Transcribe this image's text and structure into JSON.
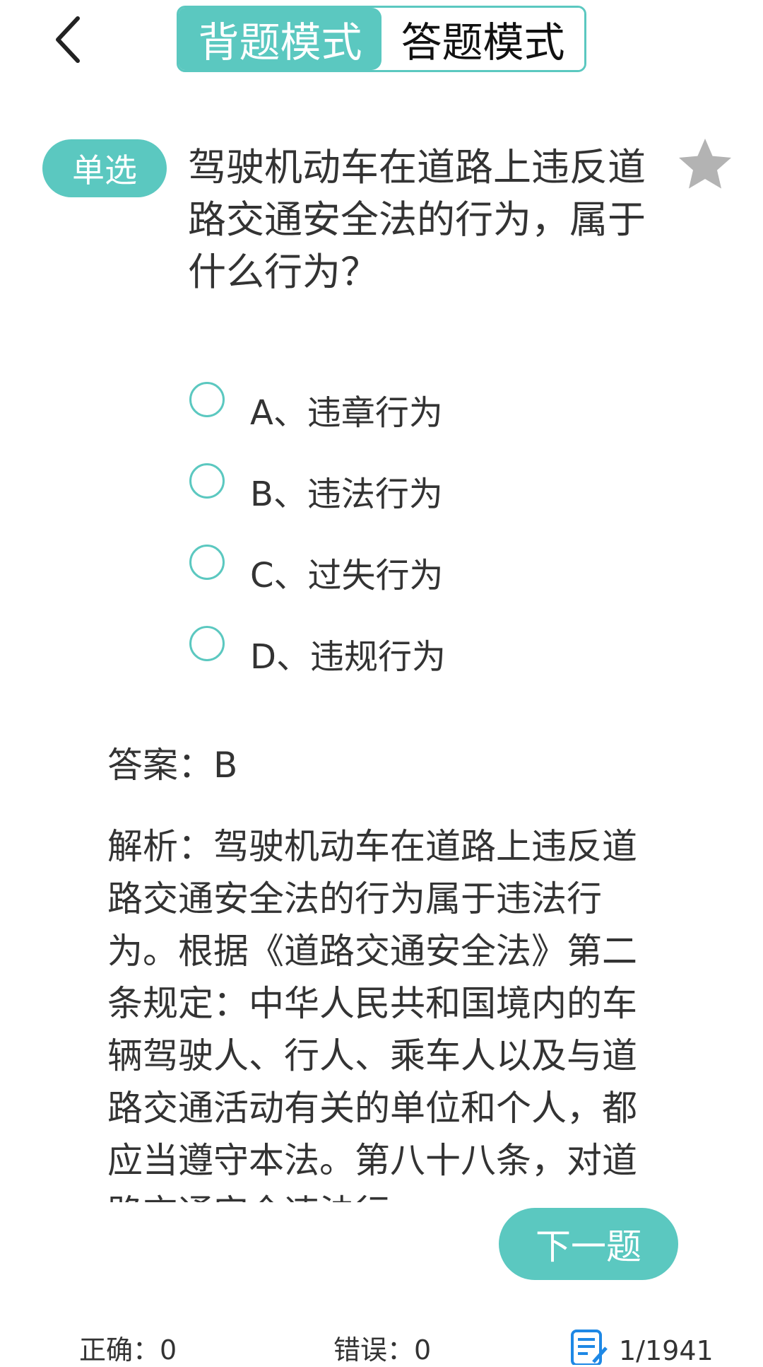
{
  "header": {
    "mode_tabs": [
      {
        "label": "背题模式",
        "active": true
      },
      {
        "label": "答题模式",
        "active": false
      }
    ]
  },
  "question": {
    "type": "单选",
    "text": "驾驶机动车在道路上违反道路交通安全法的行为，属于什么行为？",
    "options": [
      {
        "label": "A、违章行为"
      },
      {
        "label": "B、违法行为"
      },
      {
        "label": "C、过失行为"
      },
      {
        "label": "D、违规行为"
      }
    ]
  },
  "answer": {
    "text": "答案：B"
  },
  "analysis": {
    "text": "解析：驾驶机动车在道路上违反道路交通安全法的行为属于违法行为。根据《道路交通安全法》第二条规定：中华人民共和国境内的车辆驾驶人、行人、乘车人以及与道路交通活动有关的单位和个人，都应当遵守本法。第八十八条，对道路交通安全违法行"
  },
  "actions": {
    "next_label": "下一题"
  },
  "footer": {
    "correct": "正确：0",
    "wrong": "错误：0",
    "progress": "1/1941"
  },
  "colors": {
    "accent": "#5bc8c0",
    "text": "#333333",
    "star": "#b3b3b3",
    "sheet_icon": "#1e88e5"
  },
  "icons": {
    "back": "chevron-left-icon",
    "favorite": "star-icon",
    "answer_sheet": "answer-sheet-icon"
  }
}
